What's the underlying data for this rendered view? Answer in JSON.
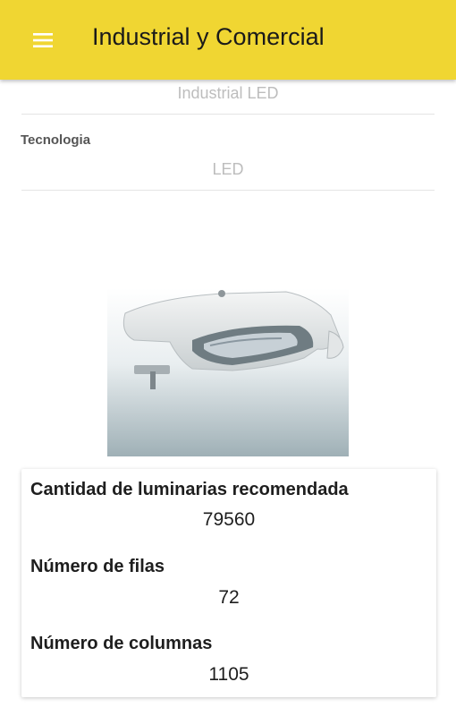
{
  "appbar": {
    "title": "Industrial y Comercial",
    "menu_icon": "hamburger-menu-icon"
  },
  "form": {
    "category_value": "Industrial LED",
    "technology_label": "Tecnologia",
    "technology_value": "LED"
  },
  "product_image": {
    "icon": "street-luminaire-image"
  },
  "results": {
    "luminaires_label": "Cantidad de luminarias recomendada",
    "luminaires_value": "79560",
    "rows_label": "Número de filas",
    "rows_value": "72",
    "columns_label": "Número de columnas",
    "columns_value": "1105"
  },
  "colors": {
    "appbar": "#f0d632",
    "muted_text": "#bdbdbd",
    "label_text": "#555555",
    "primary_text": "#1e1e1e"
  }
}
